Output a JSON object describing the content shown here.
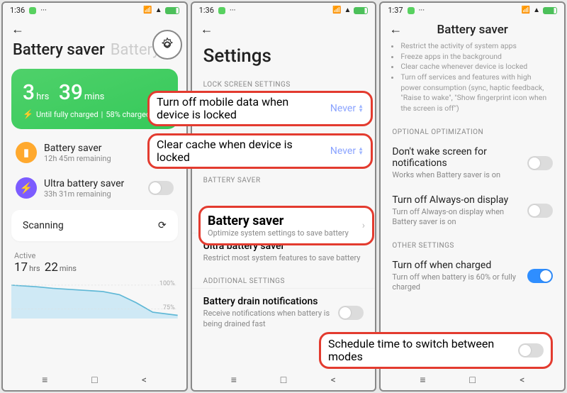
{
  "panel1": {
    "time": "1:36",
    "dots": "···",
    "title": "Battery saver",
    "title_ghost": "Battery",
    "green": {
      "h": "3",
      "h_unit": "hrs",
      "m": "39",
      "m_unit": "mins",
      "sub_prefix": "Until fully charged",
      "sub_suffix": "58% charged"
    },
    "mode_saver": {
      "title": "Battery saver",
      "sub": "12h 45m remaining"
    },
    "mode_ultra": {
      "title": "Ultra battery saver",
      "sub": "33h 31m remaining"
    },
    "scanning": "Scanning",
    "active_label": "Active",
    "active_h": "17",
    "active_h_unit": "hrs",
    "active_m": "22",
    "active_m_unit": "mins",
    "y100": "100%",
    "y75": "75%"
  },
  "panel2": {
    "time": "1:36",
    "dots": "···",
    "title": "Settings",
    "sect_lock": "LOCK SCREEN SETTINGS",
    "sect_batt": "BATTERY SAVER",
    "sect_add": "ADDITIONAL SETTINGS",
    "ultra_title": "Ultra battery saver",
    "ultra_sub": "Restrict most system features to save battery",
    "drain_title": "Battery drain notifications",
    "drain_sub": "Receive notifications when battery is being drained fast"
  },
  "panel3": {
    "time": "1:37",
    "dots": "···",
    "title": "Battery saver",
    "bullets": [
      "Restrict the activity of system apps",
      "Freeze apps in the background",
      "Clear cache whenever device is locked",
      "Turn off services and features with high power consumption (sync, haptic feedback, \"Raise to wake\", \"Show fingerprint icon when the screen is off\")"
    ],
    "sect_opt": "OPTIONAL OPTIMIZATION",
    "wake_title": "Don't wake screen for notifications",
    "wake_sub": "Works when Battery saver is on",
    "aod_title": "Turn off Always-on display",
    "aod_sub": "Turn off Always-on display when Battery saver is on",
    "sect_other": "OTHER SETTINGS",
    "charged_title": "Turn off when charged",
    "charged_sub": "Turn off when battery is 60% or fully charged"
  },
  "highlights": {
    "mobile_data": "Turn off mobile data when device is locked",
    "clear_cache": "Clear cache when device is locked",
    "never": "Never",
    "batt_saver": "Battery saver",
    "batt_saver_sub": "Optimize system settings to save battery",
    "schedule": "Schedule time to switch between modes"
  }
}
